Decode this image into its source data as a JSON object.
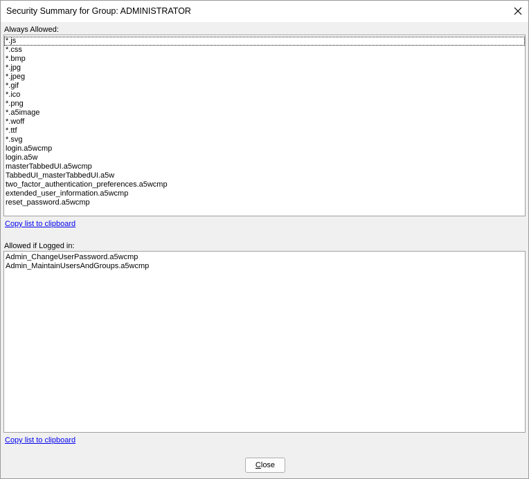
{
  "window": {
    "title": "Security Summary for Group: ADMINISTRATOR"
  },
  "always_allowed": {
    "label": "Always Allowed:",
    "items": [
      "*.js",
      "*.css",
      "*.bmp",
      "*.jpg",
      "*.jpeg",
      "*.gif",
      "*.ico",
      "*.png",
      "*.a5image",
      "*.woff",
      "*.ttf",
      "*.svg",
      "login.a5wcmp",
      "login.a5w",
      "masterTabbedUI.a5wcmp",
      "TabbedUI_masterTabbedUI.a5w",
      "two_factor_authentication_preferences.a5wcmp",
      "extended_user_information.a5wcmp",
      "reset_password.a5wcmp"
    ],
    "copy_link": "Copy list to clipboard"
  },
  "allowed_if_logged_in": {
    "label": "Allowed if Logged in:",
    "items": [
      "Admin_ChangeUserPassword.a5wcmp",
      "Admin_MaintainUsersAndGroups.a5wcmp"
    ],
    "copy_link": "Copy list to clipboard"
  },
  "footer": {
    "close_label_mnemonic": "C",
    "close_label_rest": "lose"
  },
  "icons": {
    "close": "close-icon"
  }
}
